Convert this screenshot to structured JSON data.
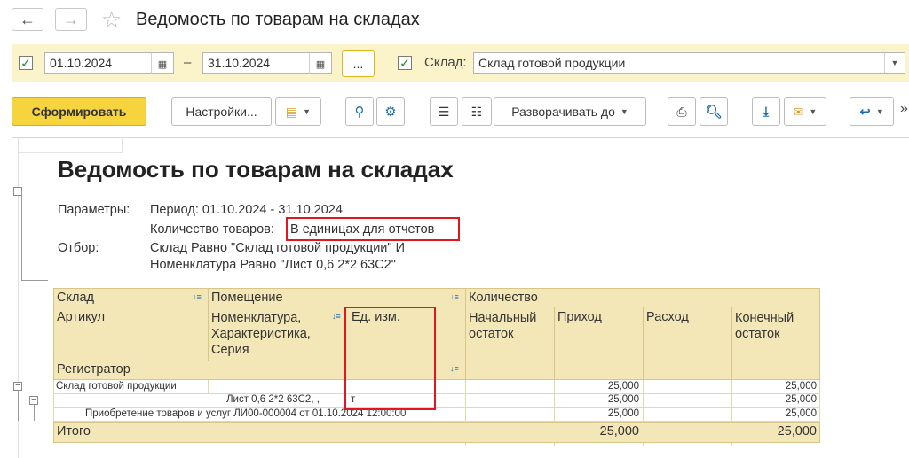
{
  "window": {
    "title": "Ведомость по товарам на складах"
  },
  "filters": {
    "date_from": "01.10.2024",
    "dash": "–",
    "date_to": "31.10.2024",
    "dots_label": "...",
    "warehouse_label": "Склад:",
    "warehouse_value": "Склад готовой продукции"
  },
  "toolbar": {
    "generate_label": "Сформировать",
    "settings_label": "Настройки...",
    "expand_label": "Разворачивать до"
  },
  "report": {
    "title": "Ведомость по товарам на складах",
    "params_label": "Параметры:",
    "period_text": "Период: 01.10.2024 - 31.10.2024",
    "qty_label": "Количество товаров:",
    "qty_value": "В единицах для отчетов",
    "filter_label": "Отбор:",
    "filter_line1": "Склад Равно \"Склад готовой продукции\" И",
    "filter_line2": "Номенклатура Равно \"Лист 0,6 2*2 63С2\""
  },
  "table": {
    "h_sklad": "Склад",
    "h_pomeshenie": "Помещение",
    "h_kolichestvo": "Количество",
    "h_artikul": "Артикул",
    "h_nomenklatura": "Номенклатура, Характеристика, Серия",
    "h_ed": "Ед. изм.",
    "h_nach": "Начальный остаток",
    "h_prihod": "Приход",
    "h_rashod": "Расход",
    "h_kon": "Конечный остаток",
    "h_registrator": "Регистратор",
    "rows": [
      {
        "label": "Склад готовой продукции",
        "ed": "",
        "nach": "",
        "prihod": "25,000",
        "rashod": "",
        "kon": "25,000"
      },
      {
        "label": "Лист 0,6 2*2 63С2, ,",
        "ed": "т",
        "nach": "",
        "prihod": "25,000",
        "rashod": "",
        "kon": "25,000"
      },
      {
        "label": "Приобретение товаров и услуг ЛИ00-000004 от 01.10.2024 12:00:00",
        "ed": "",
        "nach": "",
        "prihod": "25,000",
        "rashod": "",
        "kon": "25,000"
      }
    ],
    "total_label": "Итого",
    "total_prihod": "25,000",
    "total_kon": "25,000"
  }
}
